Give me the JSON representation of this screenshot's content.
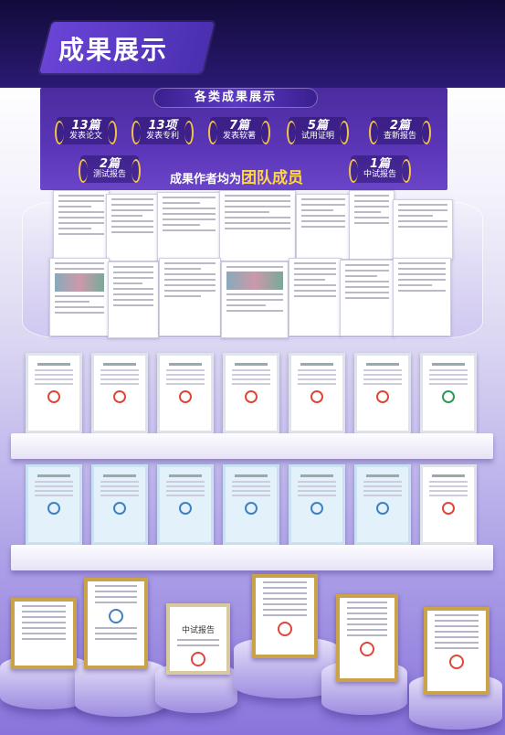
{
  "header": {
    "title": "成果展示"
  },
  "panel": {
    "heading": "各类成果展示",
    "members_prefix": "成果作者均为",
    "members_highlight": "团队成员"
  },
  "badges": [
    {
      "num": "13篇",
      "label": "发表论文"
    },
    {
      "num": "13项",
      "label": "发表专利"
    },
    {
      "num": "7篇",
      "label": "发表软著"
    },
    {
      "num": "5篇",
      "label": "试用证明"
    },
    {
      "num": "2篇",
      "label": "查新报告"
    },
    {
      "num": "2篇",
      "label": "测试报告"
    },
    {
      "num": "1篇",
      "label": "中试报告"
    }
  ],
  "trophy": {
    "report_title": "中试报告"
  },
  "colors": {
    "accent": "#5b36b8",
    "gold": "#f2c24b",
    "highlight": "#ffd54a"
  }
}
